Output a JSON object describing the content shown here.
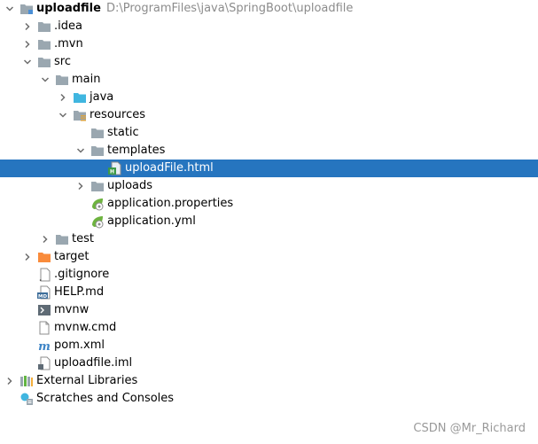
{
  "tree": [
    {
      "label": "uploadfile",
      "path": "D:\\ProgramFiles\\java\\SpringBoot\\uploadfile",
      "depth": 0,
      "arrow": "down",
      "icon": "module-folder-icon",
      "bold": true
    },
    {
      "label": ".idea",
      "depth": 1,
      "arrow": "right",
      "icon": "folder-icon"
    },
    {
      "label": ".mvn",
      "depth": 1,
      "arrow": "right",
      "icon": "folder-icon"
    },
    {
      "label": "src",
      "depth": 1,
      "arrow": "down",
      "icon": "folder-icon"
    },
    {
      "label": "main",
      "depth": 2,
      "arrow": "down",
      "icon": "folder-icon"
    },
    {
      "label": "java",
      "depth": 3,
      "arrow": "right",
      "icon": "source-folder-icon"
    },
    {
      "label": "resources",
      "depth": 3,
      "arrow": "down",
      "icon": "resources-folder-icon"
    },
    {
      "label": "static",
      "depth": 4,
      "arrow": "none",
      "icon": "folder-icon"
    },
    {
      "label": "templates",
      "depth": 4,
      "arrow": "down",
      "icon": "folder-icon"
    },
    {
      "label": "uploadFile.html",
      "depth": 5,
      "arrow": "none",
      "icon": "html-file-icon",
      "selected": true
    },
    {
      "label": "uploads",
      "depth": 4,
      "arrow": "right",
      "icon": "folder-icon"
    },
    {
      "label": "application.properties",
      "depth": 4,
      "arrow": "none",
      "icon": "spring-config-icon"
    },
    {
      "label": "application.yml",
      "depth": 4,
      "arrow": "none",
      "icon": "spring-config-icon"
    },
    {
      "label": "test",
      "depth": 2,
      "arrow": "right",
      "icon": "folder-icon"
    },
    {
      "label": "target",
      "depth": 1,
      "arrow": "right",
      "icon": "excluded-folder-icon"
    },
    {
      "label": ".gitignore",
      "depth": 1,
      "arrow": "none",
      "icon": "gitignore-file-icon"
    },
    {
      "label": "HELP.md",
      "depth": 1,
      "arrow": "none",
      "icon": "markdown-file-icon"
    },
    {
      "label": "mvnw",
      "depth": 1,
      "arrow": "none",
      "icon": "shell-file-icon"
    },
    {
      "label": "mvnw.cmd",
      "depth": 1,
      "arrow": "none",
      "icon": "text-file-icon"
    },
    {
      "label": "pom.xml",
      "depth": 1,
      "arrow": "none",
      "icon": "maven-pom-icon"
    },
    {
      "label": "uploadfile.iml",
      "depth": 1,
      "arrow": "none",
      "icon": "iml-file-icon"
    },
    {
      "label": "External Libraries",
      "depth": 0,
      "arrow": "right",
      "icon": "external-libraries-icon"
    },
    {
      "label": "Scratches and Consoles",
      "depth": 0,
      "arrow": "none",
      "icon": "scratches-icon"
    }
  ],
  "watermark": "CSDN @Mr_Richard",
  "colors": {
    "selection": "#2675bf",
    "folder": "#9aa7b0",
    "source_folder": "#40b6e0",
    "excluded_folder": "#f98b3b",
    "spring": "#6db33f",
    "path_text": "#8c8c8c",
    "arrow": "#6e6e6e"
  }
}
